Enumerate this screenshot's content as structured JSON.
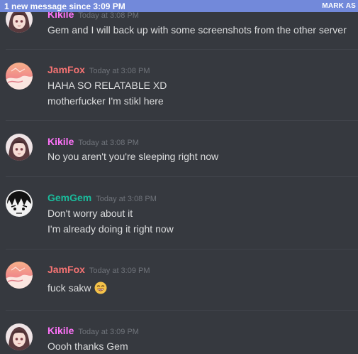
{
  "banner": {
    "text": "1 new message since 3:09 PM",
    "action": "MARK AS"
  },
  "colors": {
    "banner": "#7289da",
    "background": "#36393f",
    "kikile": "#ff73fa",
    "jamfox": "#f57373",
    "gemgem": "#1abc9c",
    "timestamp": "#6f737a",
    "message_text": "#dcddde"
  },
  "messages": [
    {
      "author": "Kikile",
      "avatar": "anime-girl-avatar",
      "timestamp": "Today at 3:08 PM",
      "lines": [
        "Gem and I will back up with some screenshots from the other server"
      ]
    },
    {
      "author": "JamFox",
      "avatar": "pink-sunset-avatar",
      "timestamp": "Today at 3:08 PM",
      "lines": [
        "HAHA SO RELATABLE XD",
        "motherfucker I'm stikl here"
      ]
    },
    {
      "author": "Kikile",
      "avatar": "anime-girl-avatar",
      "timestamp": "Today at 3:08 PM",
      "lines": [
        "No you aren't you're sleeping right now"
      ]
    },
    {
      "author": "GemGem",
      "avatar": "manga-face-avatar",
      "timestamp": "Today at 3:08 PM",
      "lines": [
        "Don't worry about it",
        "I'm already doing it right now"
      ]
    },
    {
      "author": "JamFox",
      "avatar": "pink-sunset-avatar",
      "timestamp": "Today at 3:09 PM",
      "lines": [
        "fuck sakw"
      ],
      "emoji": "laughing-face-emoji"
    },
    {
      "author": "Kikile",
      "avatar": "anime-girl-avatar",
      "timestamp": "Today at 3:09 PM",
      "lines": [
        "Oooh thanks Gem"
      ]
    }
  ]
}
